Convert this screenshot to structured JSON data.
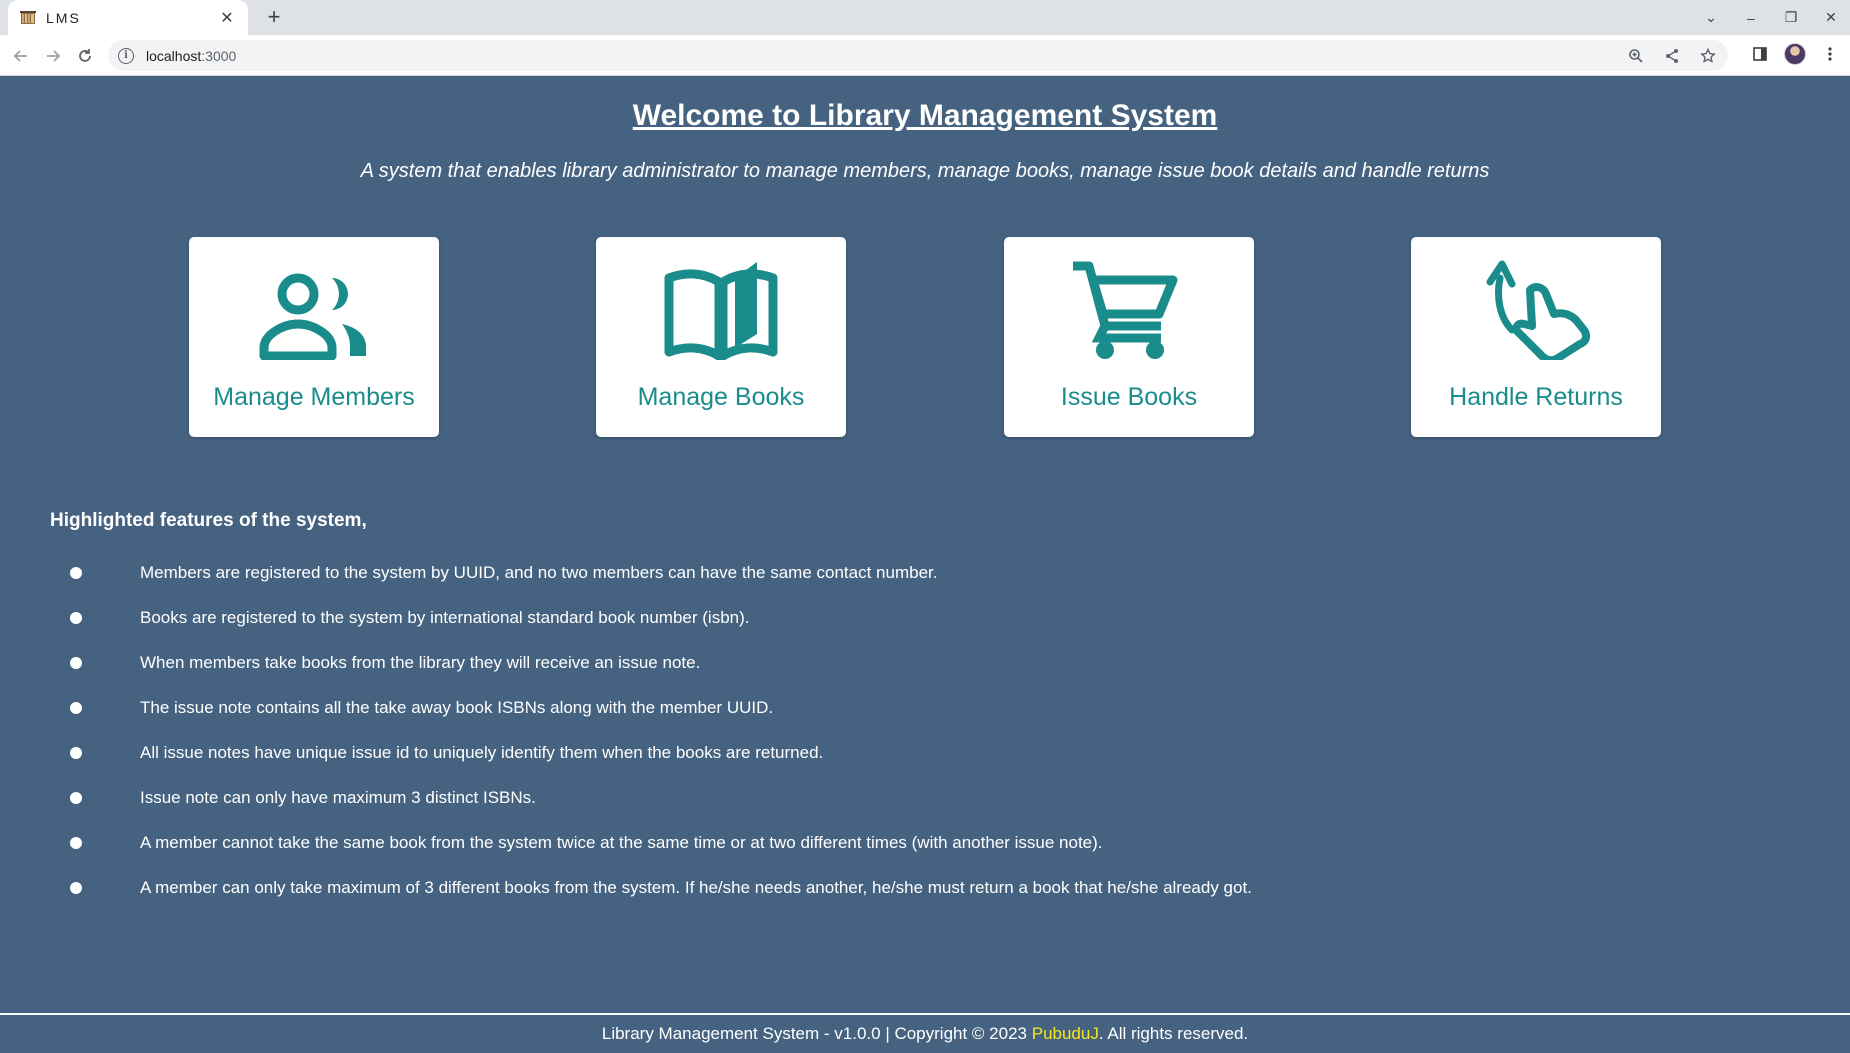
{
  "browser": {
    "tab_title": "LMS",
    "url_host": "localhost",
    "url_port": ":3000"
  },
  "page": {
    "title": "Welcome to Library Management System",
    "subtitle": "A system that enables library administrator to manage members, manage books, manage issue book details and handle returns"
  },
  "cards": [
    {
      "label": "Manage Members",
      "icon": "people-icon"
    },
    {
      "label": "Manage Books",
      "icon": "open-book-icon"
    },
    {
      "label": "Issue Books",
      "icon": "shopping-cart-icon"
    },
    {
      "label": "Handle Returns",
      "icon": "swipe-back-hand-icon"
    }
  ],
  "features": {
    "heading": "Highlighted features of the system,",
    "items": [
      "Members are registered to the system by UUID, and no two members can have the same contact number.",
      "Books are registered to the system by international standard book number (isbn).",
      "When members take books from the library they will receive an issue note.",
      "The issue note contains all the take away book ISBNs along with the member UUID.",
      "All issue notes have unique issue id to uniquely identify them when the books are returned.",
      "Issue note can only have maximum 3 distinct ISBNs.",
      "A member cannot take the same book from the system twice at the same time or at two different times (with another issue note).",
      "A member can only take maximum of 3 different books from the system. If he/she needs another, he/she must return a book that he/she already got."
    ]
  },
  "footer": {
    "prefix": "Library Management System - v1.0.0 | Copyright © 2023 ",
    "author": "PubuduJ",
    "suffix": ". All rights reserved."
  },
  "colors": {
    "background": "#456280",
    "accent": "#1a8c8c",
    "author_link": "#f5e71c"
  }
}
